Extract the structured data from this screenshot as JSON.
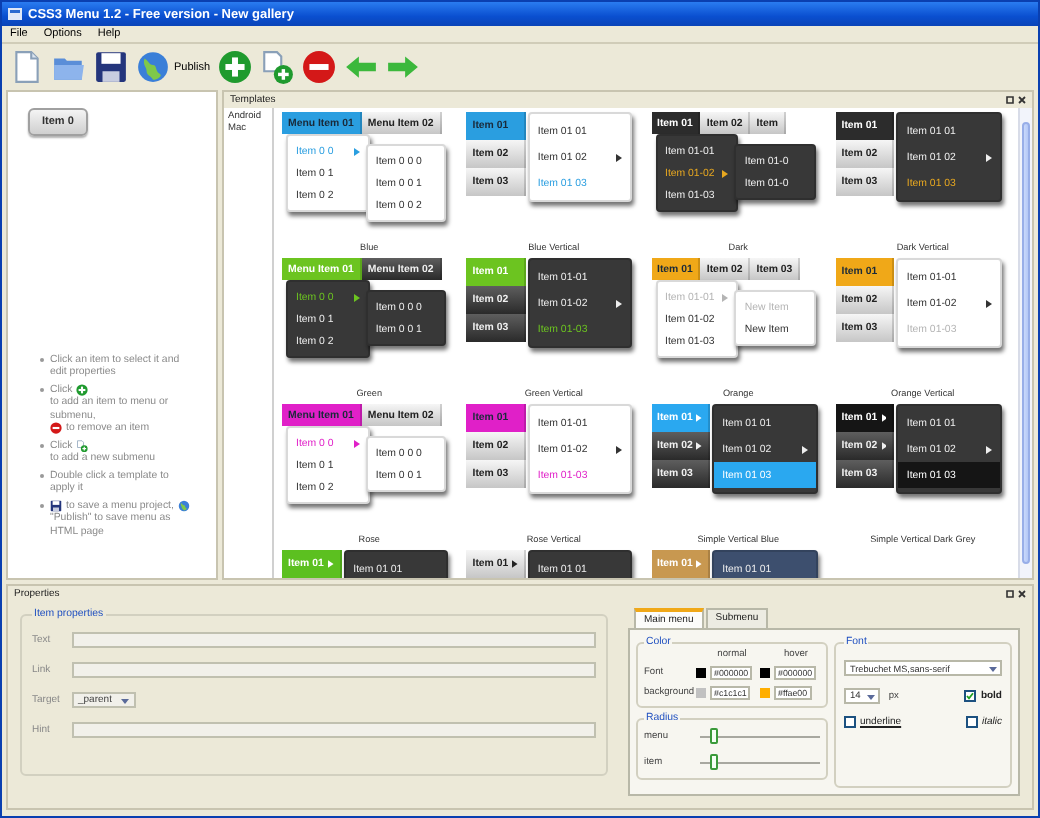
{
  "window": {
    "title": "CSS3 Menu 1.2 - Free version - New gallery"
  },
  "menu_bar": [
    "File",
    "Options",
    "Help"
  ],
  "toolbar": [
    {
      "kind": "new"
    },
    {
      "kind": "open"
    },
    {
      "kind": "save"
    },
    {
      "kind": "publish",
      "label": "Publish"
    },
    {
      "kind": "add"
    },
    {
      "kind": "add_submenu"
    },
    {
      "kind": "remove"
    },
    {
      "kind": "back"
    },
    {
      "kind": "forward"
    }
  ],
  "menu_preview": {
    "items": [
      "Item 0"
    ]
  },
  "help": [
    [
      {
        "kind": "text",
        "text": "Click an item to select it and edit properties"
      }
    ],
    [
      {
        "kind": "text",
        "text": "Click"
      },
      {
        "kind": "add"
      },
      {
        "kind": "text",
        "text": "to add an item to menu or submenu,"
      },
      {
        "kind": "remove"
      },
      {
        "kind": "text",
        "text": "to remove an item"
      }
    ],
    [
      {
        "kind": "text",
        "text": "Click"
      },
      {
        "kind": "add_submenu"
      },
      {
        "kind": "text",
        "text": "to add a new submenu"
      }
    ],
    [
      {
        "kind": "text",
        "text": "Double click a template to apply it"
      }
    ],
    [
      {
        "kind": "save"
      },
      {
        "kind": "text",
        "text": "to save a menu project,"
      },
      {
        "kind": "publish"
      },
      {
        "kind": "text",
        "text": "\"Publish\" to save menu as HTML page"
      }
    ]
  ],
  "templates_panel": {
    "title": "Templates",
    "categories": [
      "Android",
      "Mac"
    ],
    "templates": [
      {
        "name": "Blue",
        "kind": "blue",
        "top": [
          {
            "label": "Menu Item 01",
            "selected": true
          },
          {
            "label": "Menu Item 02",
            "selected": false
          }
        ],
        "dropdown": [
          {
            "label": "Item 0 0",
            "selected": true,
            "has_submenu": true
          },
          {
            "label": "Item 0 1",
            "selected": false,
            "has_submenu": false
          },
          {
            "label": "Item 0 2",
            "selected": false,
            "has_submenu": false
          }
        ],
        "submenu": [
          {
            "label": "Item 0 0 0",
            "selected": false,
            "has_submenu": false
          },
          {
            "label": "Item 0 0 1",
            "selected": false,
            "has_submenu": false
          },
          {
            "label": "Item 0 0 2",
            "selected": false,
            "has_submenu": false
          }
        ]
      },
      {
        "name": "Blue Vertical",
        "kind": "blue_vertical",
        "top": [
          {
            "label": "Item 01",
            "selected": true,
            "has_submenu": false
          },
          {
            "label": "Item 02",
            "selected": false,
            "has_submenu": false
          },
          {
            "label": "Item 03",
            "selected": false,
            "has_submenu": false
          }
        ],
        "submenu": [
          {
            "label": "Item 01 01",
            "selected": false,
            "has_submenu": false
          },
          {
            "label": "Item 01 02",
            "selected": false,
            "has_submenu": true
          },
          {
            "label": "Item 01 03",
            "selected": true,
            "has_submenu": false
          }
        ]
      },
      {
        "name": "Dark",
        "kind": "dark",
        "top": [
          {
            "label": "Item 01",
            "selected": true
          },
          {
            "label": "Item 02",
            "selected": false
          },
          {
            "label": "Item",
            "selected": false
          }
        ],
        "dropdown": [
          {
            "label": "Item 01-01",
            "selected": false,
            "has_submenu": false
          },
          {
            "label": "Item 01-02",
            "selected": true,
            "has_submenu": true
          },
          {
            "label": "Item 01-03",
            "selected": false,
            "has_submenu": false
          }
        ],
        "submenu": [
          {
            "label": "Item 01-0",
            "selected": false,
            "has_submenu": false
          },
          {
            "label": "Item 01-0",
            "selected": false,
            "has_submenu": false
          }
        ]
      },
      {
        "name": "Dark Vertical",
        "kind": "dark_vertical",
        "top": [
          {
            "label": "Item 01",
            "selected": true,
            "has_submenu": false
          },
          {
            "label": "Item 02",
            "selected": false,
            "has_submenu": false
          },
          {
            "label": "Item 03",
            "selected": false,
            "has_submenu": false
          }
        ],
        "submenu": [
          {
            "label": "Item 01 01",
            "selected": false,
            "has_submenu": false
          },
          {
            "label": "Item 01 02",
            "selected": false,
            "has_submenu": true
          },
          {
            "label": "Item 01 03",
            "selected": true,
            "has_submenu": false
          }
        ]
      },
      {
        "name": "Green",
        "kind": "green",
        "top": [
          {
            "label": "Menu Item 01",
            "selected": true
          },
          {
            "label": "Menu Item 02",
            "selected": false
          }
        ],
        "dropdown": [
          {
            "label": "Item 0 0",
            "selected": true,
            "has_submenu": true
          },
          {
            "label": "Item 0 1",
            "selected": false,
            "has_submenu": false
          },
          {
            "label": "Item 0 2",
            "selected": false,
            "has_submenu": false
          }
        ],
        "submenu": [
          {
            "label": "Item 0 0 0",
            "selected": false,
            "has_submenu": false
          },
          {
            "label": "Item 0 0 1",
            "selected": false,
            "has_submenu": false
          }
        ]
      },
      {
        "name": "Green Vertical",
        "kind": "green_vertical",
        "top": [
          {
            "label": "Item 01",
            "selected": true,
            "has_submenu": false
          },
          {
            "label": "Item 02",
            "selected": false,
            "has_submenu": false
          },
          {
            "label": "Item 03",
            "selected": false,
            "has_submenu": false
          }
        ],
        "submenu": [
          {
            "label": "Item 01-01",
            "selected": false,
            "has_submenu": false
          },
          {
            "label": "Item 01-02",
            "selected": false,
            "has_submenu": true
          },
          {
            "label": "Item 01-03",
            "selected": true,
            "has_submenu": false
          }
        ]
      },
      {
        "name": "Orange",
        "kind": "orange",
        "top": [
          {
            "label": "Item 01",
            "selected": true
          },
          {
            "label": "Item 02",
            "selected": false
          },
          {
            "label": "Item 03",
            "selected": false
          }
        ],
        "dropdown": [
          {
            "label": "Item 01-01",
            "selected": true,
            "has_submenu": true
          },
          {
            "label": "Item 01-02",
            "selected": false,
            "has_submenu": false
          },
          {
            "label": "Item 01-03",
            "selected": false,
            "has_submenu": false
          }
        ],
        "submenu": [
          {
            "label": "New Item",
            "selected": true,
            "has_submenu": false
          },
          {
            "label": "New Item",
            "selected": false,
            "has_submenu": false
          }
        ]
      },
      {
        "name": "Orange Vertical",
        "kind": "orange_vertical",
        "top": [
          {
            "label": "Item 01",
            "selected": true,
            "has_submenu": false
          },
          {
            "label": "Item 02",
            "selected": false,
            "has_submenu": false
          },
          {
            "label": "Item 03",
            "selected": false,
            "has_submenu": false
          }
        ],
        "submenu": [
          {
            "label": "Item 01-01",
            "selected": false,
            "has_submenu": false
          },
          {
            "label": "Item 01-02",
            "selected": false,
            "has_submenu": true
          },
          {
            "label": "Item 01-03",
            "selected": true,
            "has_submenu": false
          }
        ]
      },
      {
        "name": "Rose",
        "kind": "rose",
        "top": [
          {
            "label": "Menu Item 01",
            "selected": true
          },
          {
            "label": "Menu Item 02",
            "selected": false
          }
        ],
        "dropdown": [
          {
            "label": "Item 0 0",
            "selected": true,
            "has_submenu": true
          },
          {
            "label": "Item 0 1",
            "selected": false,
            "has_submenu": false
          },
          {
            "label": "Item 0 2",
            "selected": false,
            "has_submenu": false
          }
        ],
        "submenu": [
          {
            "label": "Item 0 0 0",
            "selected": false,
            "has_submenu": false
          },
          {
            "label": "Item 0 0 1",
            "selected": false,
            "has_submenu": false
          }
        ]
      },
      {
        "name": "Rose Vertical",
        "kind": "rose_vertical",
        "top": [
          {
            "label": "Item 01",
            "selected": true,
            "has_submenu": false
          },
          {
            "label": "Item 02",
            "selected": false,
            "has_submenu": false
          },
          {
            "label": "Item 03",
            "selected": false,
            "has_submenu": false
          }
        ],
        "submenu": [
          {
            "label": "Item 01-01",
            "selected": false,
            "has_submenu": false
          },
          {
            "label": "Item 01-02",
            "selected": false,
            "has_submenu": true
          },
          {
            "label": "Item 01-03",
            "selected": true,
            "has_submenu": false
          }
        ]
      },
      {
        "name": "Simple Vertical Blue",
        "kind": "simple_blue",
        "top": [
          {
            "label": "Item 01",
            "selected": true,
            "has_submenu": true
          },
          {
            "label": "Item 02",
            "selected": false,
            "has_submenu": true
          },
          {
            "label": "Item 03",
            "selected": false,
            "has_submenu": false
          }
        ],
        "submenu": [
          {
            "label": "Item 01 01",
            "selected": false,
            "has_submenu": false
          },
          {
            "label": "Item 01 02",
            "selected": false,
            "has_submenu": true
          },
          {
            "label": "Item 01 03",
            "selected": true,
            "has_submenu": false
          }
        ]
      },
      {
        "name": "Simple Vertical Dark Grey",
        "kind": "simple_grey",
        "top": [
          {
            "label": "Item 01",
            "selected": true,
            "has_submenu": true
          },
          {
            "label": "Item 02",
            "selected": false,
            "has_submenu": true
          },
          {
            "label": "Item 03",
            "selected": false,
            "has_submenu": false
          }
        ],
        "submenu": [
          {
            "label": "Item 01 01",
            "selected": false,
            "has_submenu": false
          },
          {
            "label": "Item 01 02",
            "selected": false,
            "has_submenu": true
          },
          {
            "label": "Item 01 03",
            "selected": true,
            "has_submenu": false
          }
        ]
      },
      {
        "kind": "simple_green",
        "top": [
          {
            "label": "Item 01",
            "selected": true,
            "has_submenu": true
          }
        ],
        "submenu": [
          {
            "label": "Item 01 01",
            "selected": false
          }
        ]
      },
      {
        "kind": "simple_silver",
        "top": [
          {
            "label": "Item 01",
            "selected": false,
            "has_submenu": true
          }
        ],
        "submenu": [
          {
            "label": "Item 01 01",
            "selected": false
          }
        ]
      },
      {
        "kind": "simple_navy",
        "top": [
          {
            "label": "Item 01",
            "selected": true,
            "has_submenu": true
          }
        ],
        "submenu": [
          {
            "label": "Item 01 01",
            "selected": false
          }
        ]
      }
    ]
  },
  "properties_panel": {
    "title": "Properties",
    "item_properties": {
      "title": "Item properties",
      "fields": [
        {
          "label": "Text",
          "kind": "text"
        },
        {
          "label": "Link",
          "kind": "text"
        },
        {
          "label": "Target",
          "kind": "select",
          "value": "_parent"
        },
        {
          "label": "Hint",
          "kind": "text"
        }
      ]
    },
    "style_tabs": [
      {
        "label": "Main menu",
        "selected": true
      },
      {
        "label": "Submenu",
        "selected": false
      }
    ],
    "color": {
      "title": "Color",
      "columns": [
        "normal",
        "hover"
      ],
      "rows": [
        {
          "label": "Font",
          "normal": "#000000",
          "hover": "#000000"
        },
        {
          "label": "background",
          "normal": "#c1c1c1",
          "hover": "#ffae00"
        }
      ]
    },
    "radius": {
      "title": "Radius",
      "sliders": [
        {
          "label": "menu",
          "level": 0.12
        },
        {
          "label": "item",
          "level": 0.12
        }
      ]
    },
    "font": {
      "title": "Font",
      "family": "Trebuchet MS,sans-serif",
      "size": "14",
      "unit": "px",
      "options": [
        {
          "label": "bold",
          "kind": "bold",
          "checked": true
        },
        {
          "label": "underline",
          "kind": "underline",
          "checked": false
        },
        {
          "label": "italic",
          "kind": "italic",
          "checked": false
        }
      ]
    }
  }
}
